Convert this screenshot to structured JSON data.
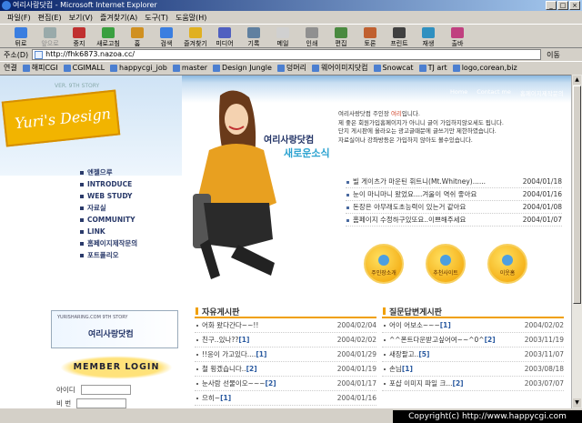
{
  "window": {
    "title": "여리사랑닷컴 - Microsoft Internet Explorer",
    "btn_min": "_",
    "btn_max": "□",
    "btn_close": "×"
  },
  "menu": [
    "파일(F)",
    "편집(E)",
    "보기(V)",
    "즐겨찾기(A)",
    "도구(T)",
    "도움말(H)"
  ],
  "toolbar": {
    "buttons": [
      {
        "label": "뒤로",
        "icon": "back-arrow-icon",
        "enabled": true
      },
      {
        "label": "앞으로",
        "icon": "forward-arrow-icon",
        "enabled": false
      },
      {
        "label": "중지",
        "icon": "stop-icon",
        "enabled": true
      },
      {
        "label": "새로고침",
        "icon": "refresh-icon",
        "enabled": true
      },
      {
        "label": "홈",
        "icon": "home-icon",
        "enabled": true
      },
      {
        "label": "검색",
        "icon": "search-icon",
        "enabled": true
      },
      {
        "label": "즐겨찾기",
        "icon": "favorites-icon",
        "enabled": true
      },
      {
        "label": "미디어",
        "icon": "media-icon",
        "enabled": true
      },
      {
        "label": "기록",
        "icon": "history-icon",
        "enabled": true
      },
      {
        "label": "메일",
        "icon": "mail-icon",
        "enabled": true
      },
      {
        "label": "인쇄",
        "icon": "print-icon",
        "enabled": true
      },
      {
        "label": "편집",
        "icon": "edit-icon",
        "enabled": true
      },
      {
        "label": "토론",
        "icon": "discuss-icon",
        "enabled": true
      },
      {
        "label": "프린트",
        "icon": "printer-icon",
        "enabled": true
      },
      {
        "label": "재생",
        "icon": "play-icon",
        "enabled": true
      },
      {
        "label": "출바",
        "icon": "bar-icon",
        "enabled": true
      }
    ]
  },
  "address": {
    "label": "주소(D)",
    "value": "http://fhk6873.nazoa.cc/",
    "go": "이동"
  },
  "links": {
    "label": "연결",
    "items": [
      "해피CGI",
      "CGIMALL",
      "happycgi_job",
      "master",
      "Design Jungle",
      "덩머리",
      "웨어이미지닷컴",
      "Snowcat",
      "TJ art",
      "logo,corean,biz"
    ]
  },
  "site": {
    "logo": "Yuri's Design",
    "vertical_caption": "VER. 9TH STORY",
    "toplinks": [
      "Home",
      "Contact me",
      "홈페이지제작문의"
    ],
    "nav": [
      "엔젤으루",
      "INTRODUCE",
      "WEB STUDY",
      "자료실",
      "COMMUNITY",
      "LINK",
      "홈페이지제작문의",
      "포트폴리오"
    ],
    "banner": {
      "small": "YURISHARING.COM 9TH STORY",
      "name": "여리사랑닷컴"
    },
    "login": {
      "title": "MEMBER LOGIN",
      "id_label": "아이디",
      "pw_label": "비 번"
    },
    "hero_title": {
      "line1": "여리사랑닷컴",
      "line2": "새로운소식"
    },
    "intro": {
      "line1_a": "여리사랑닷컴 주인장 ",
      "line1_hl": "여리",
      "line1_b": "입니다.",
      "line2": "제 좋은 회원가입홈페이지가 아니니 글이 가입하지않오세도 됩니다.",
      "line3": "단지 게시판에 올라오는 광고글때문에 글쓰기만 제한하였습니다.",
      "line4": "자료실이나 강좌방등은 가입하지 않아도 볼수있습니다."
    },
    "notices": [
      {
        "title": "빌 게이츠가 마운틴 휘트니(Mt.Whitney)......",
        "date": "2004/01/18"
      },
      {
        "title": "눈이 마니마니 왔었요....겨울이 역쉬 좋아요",
        "date": "2004/01/16"
      },
      {
        "title": "돈장은 아무래도초능력이 있는거 같아요",
        "date": "2004/01/08"
      },
      {
        "title": "홈페이지 수정하구있또요..이쁘해주세요",
        "date": "2004/01/07"
      }
    ],
    "circles": [
      "주인장소개",
      "추천사이트",
      "이웃홈"
    ],
    "free_board": {
      "title": "자유게시판",
      "posts": [
        {
          "title": "어화 왔다간다~~!!",
          "count": "",
          "date": "2004/02/04"
        },
        {
          "title": "친구..있나??",
          "count": "[1]",
          "date": "2004/02/02"
        },
        {
          "title": "!!응이 가고있다....",
          "count": "[1]",
          "date": "2004/01/29"
        },
        {
          "title": "철 횡겠습니다..",
          "count": "[2]",
          "date": "2004/01/19"
        },
        {
          "title": "눈사람 선물이오~~~",
          "count": "[2]",
          "date": "2004/01/17"
        },
        {
          "title": "으히~",
          "count": "[1]",
          "date": "2004/01/16"
        }
      ]
    },
    "qa_board": {
      "title": "질문답변게시판",
      "posts": [
        {
          "title": "어이 어보소~~~",
          "count": "[1]",
          "date": "2004/02/02"
        },
        {
          "title": "^^폰트다운받고싶어여~~^0^",
          "count": "[2]",
          "date": "2003/11/19"
        },
        {
          "title": "새장팔고..",
          "count": "[5]",
          "date": "2003/11/07"
        },
        {
          "title": "손님",
          "count": "[1]",
          "date": "2003/08/18"
        },
        {
          "title": "포샵 이미지 파일 크...",
          "count": "[2]",
          "date": "2003/07/07"
        }
      ]
    }
  },
  "footer": {
    "copyright": "Copyright(c) http://www.happycgi.com"
  },
  "colors": {
    "accent": "#f0a000",
    "titlebar": "#0a246a",
    "nav": "#2a3a6a"
  }
}
